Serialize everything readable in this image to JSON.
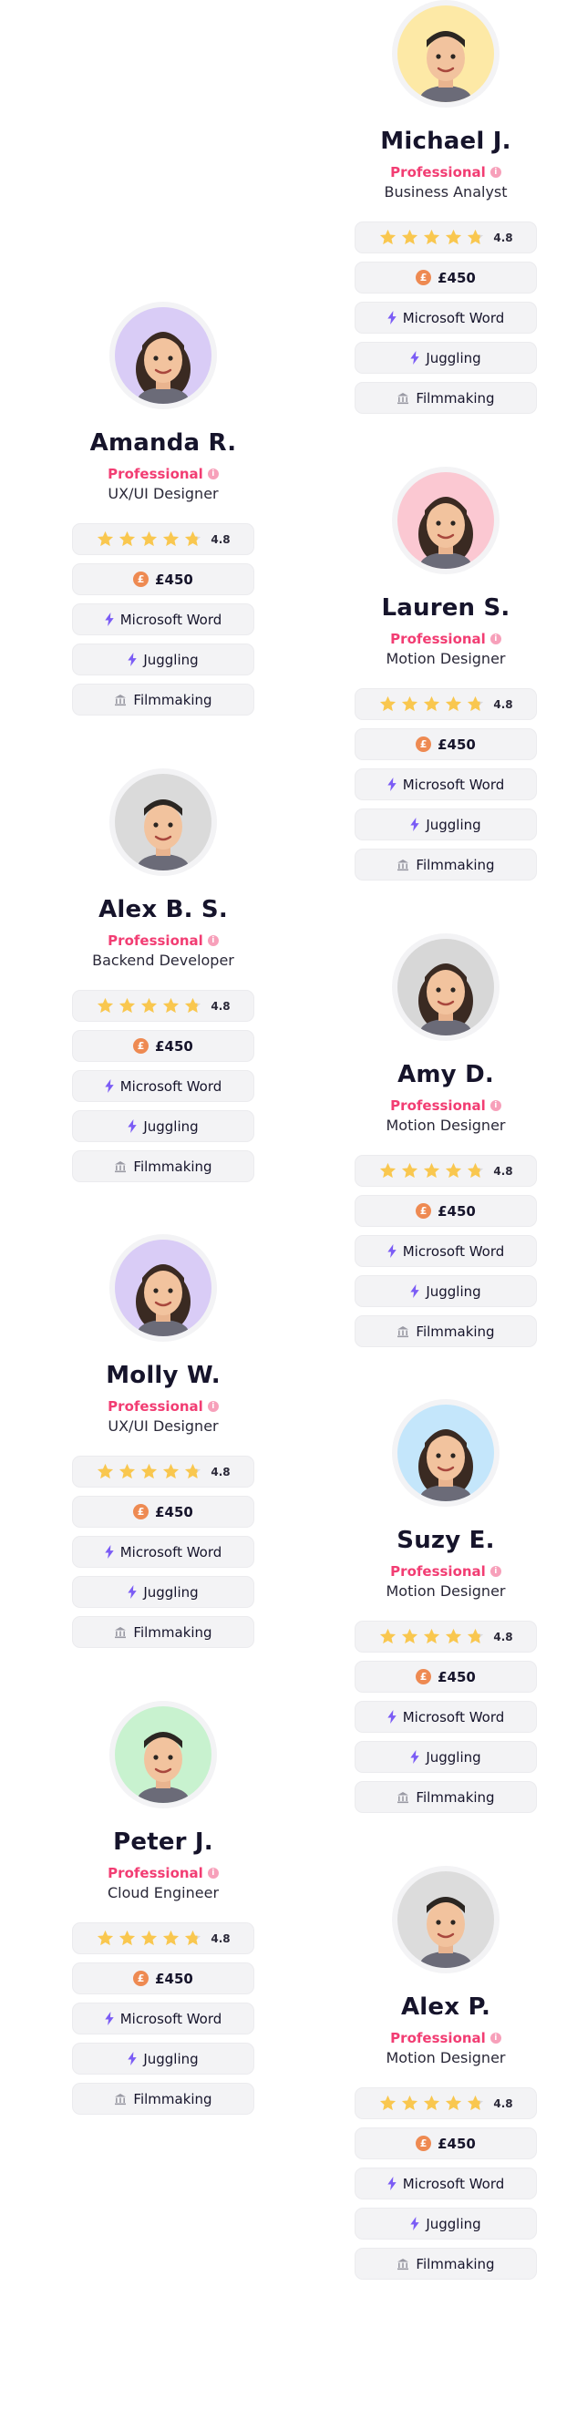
{
  "colors": {
    "accent": "#f23d73",
    "star": "#f9c74f",
    "price_icon": "#ee8a52",
    "bolt": "#7b5cf5",
    "pill_bg": "#f3f3f5"
  },
  "cards": [
    {
      "name": "Michael J.",
      "level": "Professional",
      "role": "Business Analyst",
      "rating": "4.8",
      "rating_stars": 4.8,
      "price": "£450",
      "skills": [
        "Microsoft Word",
        "Juggling",
        "Filmmaking"
      ],
      "skill_icons": [
        "bolt-icon",
        "bolt-icon",
        "bank-icon"
      ],
      "avatar_bg": "#fde9a6",
      "avatar_icon": "memoji-man-icon"
    },
    {
      "name": "Amanda R.",
      "level": "Professional",
      "role": "UX/UI Designer",
      "rating": "4.8",
      "rating_stars": 4.8,
      "price": "£450",
      "skills": [
        "Microsoft Word",
        "Juggling",
        "Filmmaking"
      ],
      "skill_icons": [
        "bolt-icon",
        "bolt-icon",
        "bank-icon"
      ],
      "avatar_bg": "#d9ccf6",
      "avatar_icon": "memoji-woman-icon"
    },
    {
      "name": "Lauren S.",
      "level": "Professional",
      "role": "Motion Designer",
      "rating": "4.8",
      "rating_stars": 4.8,
      "price": "£450",
      "skills": [
        "Microsoft Word",
        "Juggling",
        "Filmmaking"
      ],
      "skill_icons": [
        "bolt-icon",
        "bolt-icon",
        "bank-icon"
      ],
      "avatar_bg": "#fbc8d2",
      "avatar_icon": "memoji-woman-icon"
    },
    {
      "name": "Alex B. S.",
      "level": "Professional",
      "role": "Backend Developer",
      "rating": "4.8",
      "rating_stars": 4.8,
      "price": "£450",
      "skills": [
        "Microsoft Word",
        "Juggling",
        "Filmmaking"
      ],
      "skill_icons": [
        "bolt-icon",
        "bolt-icon",
        "bank-icon"
      ],
      "avatar_bg": "#dadada",
      "avatar_icon": "memoji-man-icon"
    },
    {
      "name": "Amy D.",
      "level": "Professional",
      "role": "Motion Designer",
      "rating": "4.8",
      "rating_stars": 4.8,
      "price": "£450",
      "skills": [
        "Microsoft Word",
        "Juggling",
        "Filmmaking"
      ],
      "skill_icons": [
        "bolt-icon",
        "bolt-icon",
        "bank-icon"
      ],
      "avatar_bg": "#d7d7d7",
      "avatar_icon": "memoji-woman-icon"
    },
    {
      "name": "Molly W.",
      "level": "Professional",
      "role": "UX/UI Designer",
      "rating": "4.8",
      "rating_stars": 4.8,
      "price": "£450",
      "skills": [
        "Microsoft Word",
        "Juggling",
        "Filmmaking"
      ],
      "skill_icons": [
        "bolt-icon",
        "bolt-icon",
        "bank-icon"
      ],
      "avatar_bg": "#d9ccf6",
      "avatar_icon": "memoji-woman-icon"
    },
    {
      "name": "Suzy E.",
      "level": "Professional",
      "role": "Motion Designer",
      "rating": "4.8",
      "rating_stars": 4.8,
      "price": "£450",
      "skills": [
        "Microsoft Word",
        "Juggling",
        "Filmmaking"
      ],
      "skill_icons": [
        "bolt-icon",
        "bolt-icon",
        "bank-icon"
      ],
      "avatar_bg": "#c4e6fb",
      "avatar_icon": "memoji-woman-icon"
    },
    {
      "name": "Peter J.",
      "level": "Professional",
      "role": "Cloud Engineer",
      "rating": "4.8",
      "rating_stars": 4.8,
      "price": "£450",
      "skills": [
        "Microsoft Word",
        "Juggling",
        "Filmmaking"
      ],
      "skill_icons": [
        "bolt-icon",
        "bolt-icon",
        "bank-icon"
      ],
      "avatar_bg": "#c8f2cf",
      "avatar_icon": "memoji-man-icon"
    },
    {
      "name": "Alex P.",
      "level": "Professional",
      "role": "Motion Designer",
      "rating": "4.8",
      "rating_stars": 4.8,
      "price": "£450",
      "skills": [
        "Microsoft Word",
        "Juggling",
        "Filmmaking"
      ],
      "skill_icons": [
        "bolt-icon",
        "bolt-icon",
        "bank-icon"
      ],
      "avatar_bg": "#dcdcdc",
      "avatar_icon": "memoji-man-icon"
    }
  ]
}
